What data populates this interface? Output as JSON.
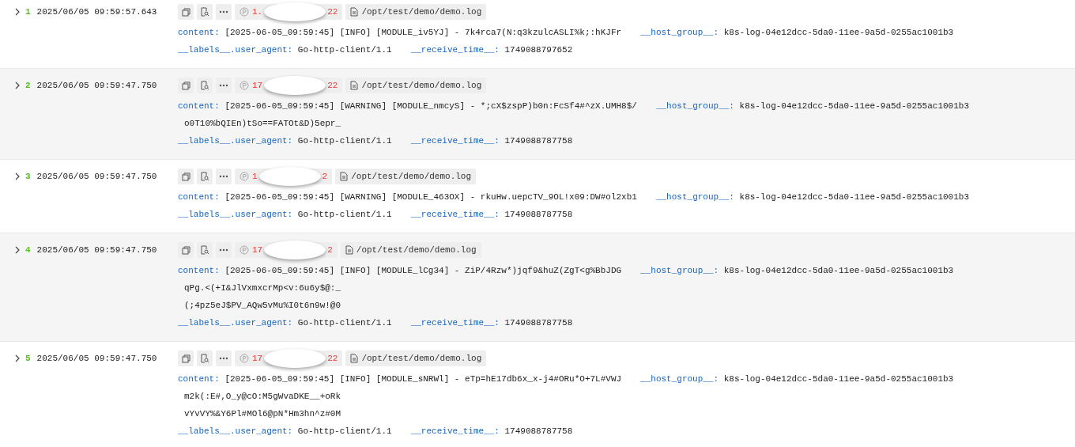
{
  "records": [
    {
      "number": "1",
      "time": "2025/06/05 09:59:57.643",
      "source": {
        "start": "1.",
        "end": "22"
      },
      "path": "/opt/test/demo/demo.log",
      "content": {
        "label": "content:",
        "lines": [
          "[2025-06-05_09:59:45] [INFO] [MODULE_iv5YJ] - 7k4rca7(N:q3kzulcASLI%k;:hKJFr"
        ]
      },
      "host_group": {
        "label": "__host_group__:",
        "value": "k8s-log-04e12dcc-5da0-11ee-9a5d-0255ac1001b3"
      },
      "meta": [
        {
          "label": "__labels__.user_agent:",
          "value": "Go-http-client/1.1"
        },
        {
          "label": "__receive_time__:",
          "value": "1749088797652"
        }
      ]
    },
    {
      "number": "2",
      "time": "2025/06/05 09:59:47.750",
      "source": {
        "start": "17",
        "end": "22"
      },
      "path": "/opt/test/demo/demo.log",
      "content": {
        "label": "content:",
        "lines": [
          "[2025-06-05_09:59:45] [WARNING] [MODULE_nmcyS] - *;cX$zspP)b0n:FcSf4#^zX.UMH8$/",
          "o0T10%bQIEn)tSo==FATOt&D)5epr_"
        ]
      },
      "host_group": {
        "label": "__host_group__:",
        "value": "k8s-log-04e12dcc-5da0-11ee-9a5d-0255ac1001b3"
      },
      "meta": [
        {
          "label": "__labels__.user_agent:",
          "value": "Go-http-client/1.1"
        },
        {
          "label": "__receive_time__:",
          "value": "1749088787758"
        }
      ]
    },
    {
      "number": "3",
      "time": "2025/06/05 09:59:47.750",
      "source": {
        "start": "1",
        "end": "2"
      },
      "path": "/opt/test/demo/demo.log",
      "content": {
        "label": "content:",
        "lines": [
          "[2025-06-05_09:59:45] [WARNING] [MODULE_463OX] - rkuHw.uepcTV_9OL!x09:DW#ol2xb1"
        ]
      },
      "host_group": {
        "label": "__host_group__:",
        "value": "k8s-log-04e12dcc-5da0-11ee-9a5d-0255ac1001b3"
      },
      "meta": [
        {
          "label": "__labels__.user_agent:",
          "value": "Go-http-client/1.1"
        },
        {
          "label": "__receive_time__:",
          "value": "1749088787758"
        }
      ]
    },
    {
      "number": "4",
      "time": "2025/06/05 09:59:47.750",
      "source": {
        "start": "17",
        "end": "2"
      },
      "path": "/opt/test/demo/demo.log",
      "content": {
        "label": "content:",
        "lines": [
          "[2025-06-05_09:59:45] [INFO] [MODULE_lCg34] - ZiP/4Rzw*)jqf9&huZ(ZgT<g%BbJDG",
          "qPg.<(+I&JlVxmxcrMp<v:6u6y$@:_",
          "(;4pz5eJ$PV_AQw5vMu%I0t6n9w!@0"
        ]
      },
      "host_group": {
        "label": "__host_group__:",
        "value": "k8s-log-04e12dcc-5da0-11ee-9a5d-0255ac1001b3"
      },
      "meta": [
        {
          "label": "__labels__.user_agent:",
          "value": "Go-http-client/1.1"
        },
        {
          "label": "__receive_time__:",
          "value": "1749088787758"
        }
      ]
    },
    {
      "number": "5",
      "time": "2025/06/05 09:59:47.750",
      "source": {
        "start": "17",
        "end": "22"
      },
      "path": "/opt/test/demo/demo.log",
      "content": {
        "label": "content:",
        "lines": [
          "[2025-06-05_09:59:45] [INFO] [MODULE_sNRWl] - eTp=hE17db6x_x-j4#ORu*O+7L#VWJ",
          "m2k(:E#,O_y@cO:M5gWvaDKE__+oRk",
          "vYvVY%&Y6Pl#MOl6@pN*Hm3hn^z#0M"
        ]
      },
      "host_group": {
        "label": "__host_group__:",
        "value": "k8s-log-04e12dcc-5da0-11ee-9a5d-0255ac1001b3"
      },
      "meta": [
        {
          "label": "__labels__.user_agent:",
          "value": "Go-http-client/1.1"
        },
        {
          "label": "__receive_time__:",
          "value": "1749088787758"
        }
      ]
    }
  ]
}
